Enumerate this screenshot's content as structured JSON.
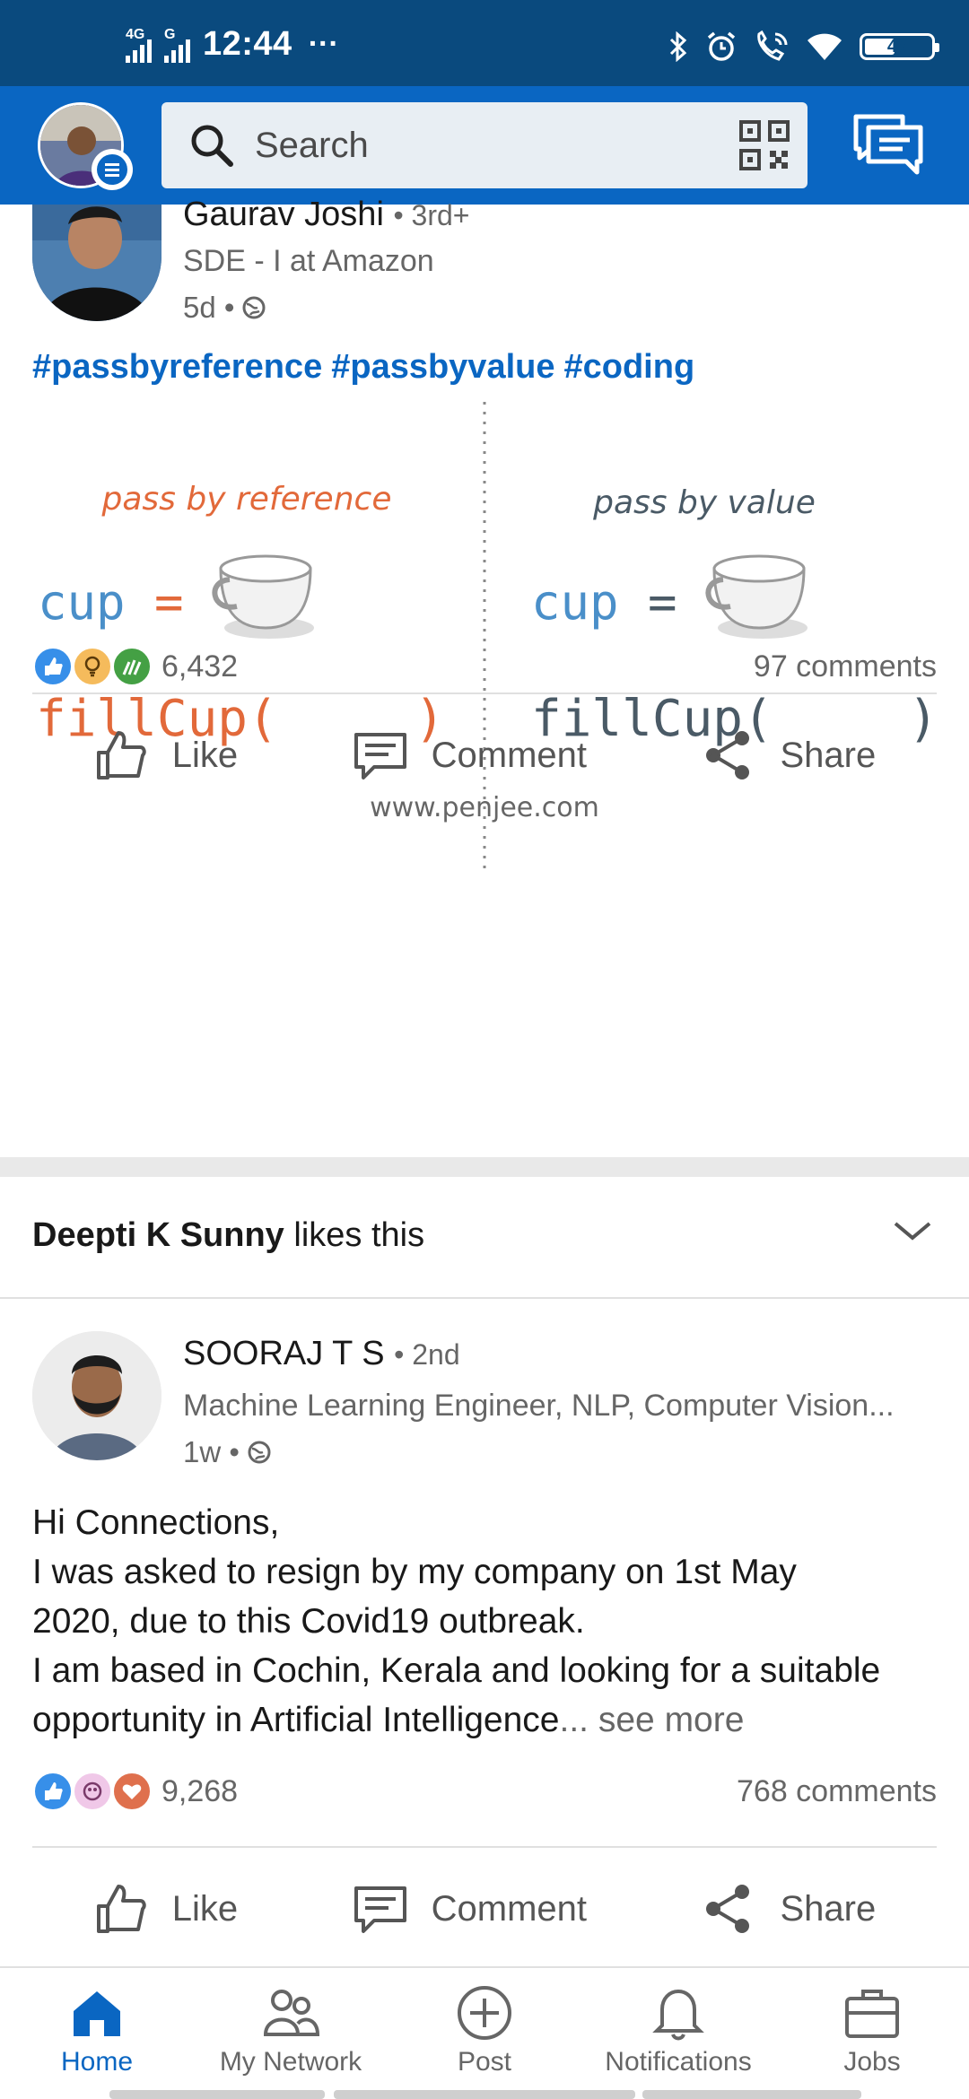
{
  "status_bar": {
    "network1": "4G",
    "network2": "G",
    "time": "12:44",
    "more": "···",
    "battery": "46",
    "battery_level": 0.46
  },
  "header": {
    "search_placeholder": "Search",
    "icons": [
      "profile-avatar",
      "menu-badge-icon",
      "search-icon",
      "qr-code-icon",
      "messaging-icon"
    ]
  },
  "colors": {
    "brand": "#0a66c2",
    "status_bar": "#0a4a7e",
    "ref_orange": "#e2693a",
    "value_gray": "#4a5a66",
    "cup_blue": "#4a8fc9"
  },
  "post1": {
    "author": "Gaurav Joshi",
    "degree": "• 3rd+",
    "headline": "SDE - I at Amazon",
    "time": "5d •",
    "hashtags": [
      "#passbyreference",
      "#passbyvalue",
      "#coding"
    ],
    "illustration": {
      "left_title": "pass by reference",
      "right_title": "pass by value",
      "left_line1": "cup",
      "left_eq": "=",
      "left_line2": "fillCup(",
      "left_paren": ")",
      "right_line1": "cup",
      "right_eq": "=",
      "right_line2": "fillCup(",
      "right_paren": ")",
      "footer": "www.penjee.com"
    },
    "reactions_count": "6,432",
    "comments": "97 comments",
    "actions": {
      "like": "Like",
      "comment": "Comment",
      "share": "Share"
    }
  },
  "social": {
    "name": "Deepti K Sunny",
    "text": " likes this"
  },
  "post2": {
    "author": "SOORAJ T S",
    "degree": "• 2nd",
    "headline": "Machine Learning Engineer, NLP, Computer Vision...",
    "time": "1w •",
    "body_lines": [
      "Hi Connections,",
      "I was asked to resign by my company on 1st May",
      "2020, due to this Covid19 outbreak.",
      "I am based in Cochin, Kerala and looking for a suitable",
      "opportunity in Artificial Intelligence"
    ],
    "ellipsis": "...",
    "see_more": " see more",
    "reactions_count": "9,268",
    "comments": "768 comments",
    "actions": {
      "like": "Like",
      "comment": "Comment",
      "share": "Share"
    }
  },
  "bottom_nav": {
    "home": "Home",
    "network": "My Network",
    "post": "Post",
    "notifications": "Notifications",
    "jobs": "Jobs"
  }
}
